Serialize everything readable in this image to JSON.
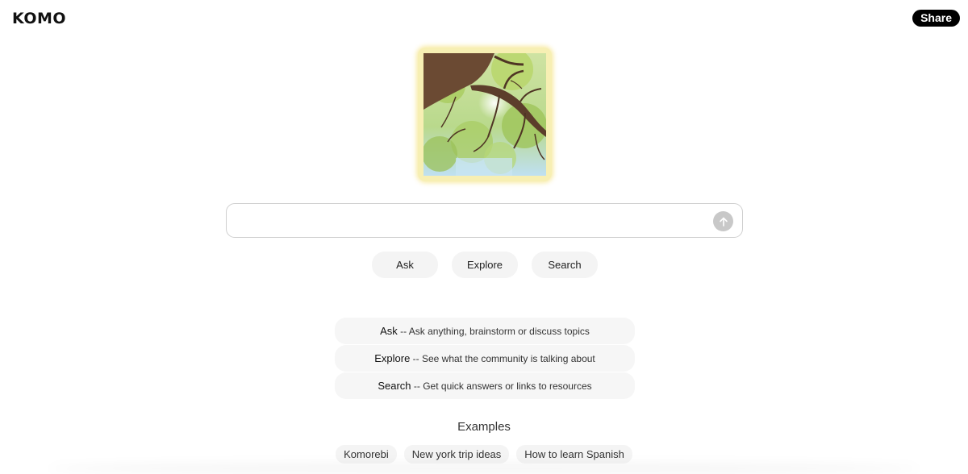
{
  "header": {
    "logo_text": "KOMO",
    "share_label": "Share"
  },
  "hero": {
    "image_name": "komorebi-tree-illustration"
  },
  "search": {
    "value": "",
    "placeholder": "",
    "submit_icon": "arrow-up-icon"
  },
  "modes": [
    {
      "label": "Ask"
    },
    {
      "label": "Explore"
    },
    {
      "label": "Search"
    }
  ],
  "descriptions": [
    {
      "term": "Ask",
      "separator": " -- ",
      "text": "Ask anything, brainstorm or discuss topics"
    },
    {
      "term": "Explore",
      "separator": " -- ",
      "text": "See what the community is talking about"
    },
    {
      "term": "Search",
      "separator": " -- ",
      "text": "Get quick answers or links to resources"
    }
  ],
  "examples": {
    "title": "Examples",
    "items": [
      {
        "label": "Komorebi"
      },
      {
        "label": "New york trip ideas"
      },
      {
        "label": "How to learn Spanish"
      }
    ]
  },
  "colors": {
    "share_bg": "#000000",
    "hero_frame": "#f7efb3",
    "chip_bg": "#f4f4f4",
    "submit_bg": "#c8c8c8"
  }
}
